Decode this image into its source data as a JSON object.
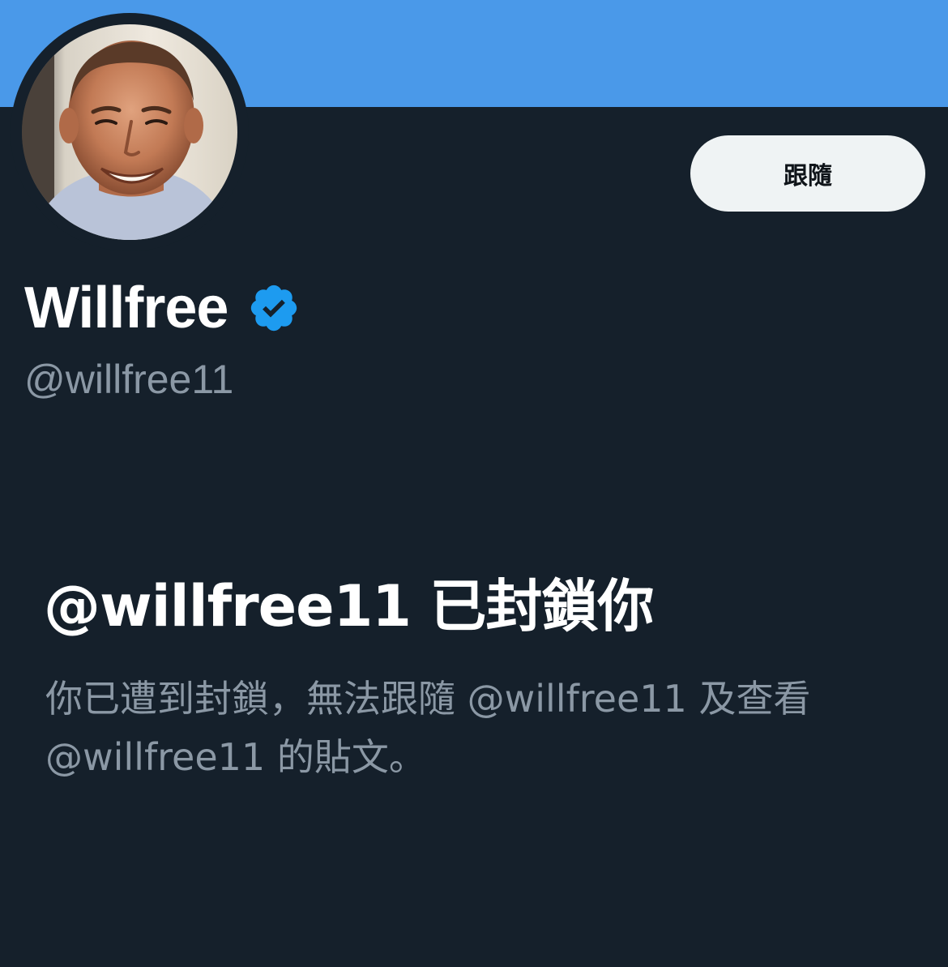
{
  "colors": {
    "background": "#15202b",
    "banner": "#4a99e9",
    "primary_text": "#ffffff",
    "secondary_text": "#8b98a5",
    "follow_button_bg": "#eff3f4",
    "follow_button_text": "#0f1419",
    "verified_badge": "#1d9bf0"
  },
  "profile": {
    "display_name": "Willfree",
    "handle": "@willfree11",
    "verified": true,
    "verified_icon": "verified-badge-icon",
    "avatar_icon": "profile-photo"
  },
  "actions": {
    "follow_label": "跟隨"
  },
  "blocked_notice": {
    "title": "@willfree11 已封鎖你",
    "description": "你已遭到封鎖，無法跟隨 @willfree11 及查看 @willfree11 的貼文。"
  }
}
